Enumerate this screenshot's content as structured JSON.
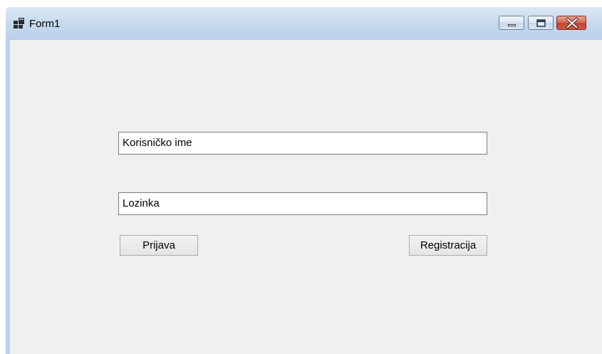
{
  "window": {
    "title": "Form1",
    "icon": "winforms-app-icon"
  },
  "caption_buttons": {
    "minimize_icon": "minimize-icon",
    "maximize_icon": "maximize-icon",
    "close_icon": "close-icon"
  },
  "form": {
    "username_value": "Korisničko ime",
    "password_value": "Lozinka",
    "login_label": "Prijava",
    "register_label": "Registracija"
  },
  "colors": {
    "client_background": "#f0f0f0",
    "titlebar": "#b9d1ea",
    "close_button": "#c5432c"
  }
}
